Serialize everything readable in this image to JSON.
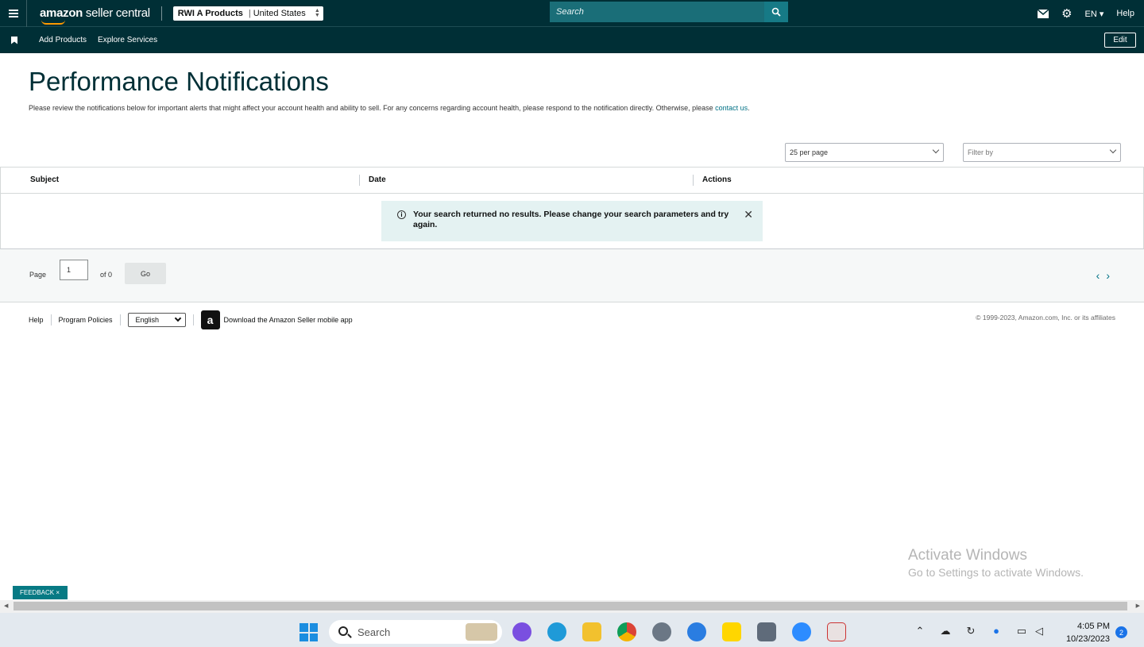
{
  "topbar": {
    "logo_bold": "amazon",
    "logo_rest": " seller central",
    "account_name": "RWI A Products",
    "account_separator": "|",
    "account_region": "United States",
    "search_placeholder": "Search",
    "language": "EN",
    "help": "Help"
  },
  "navbar": {
    "links": [
      "Add Products",
      "Explore Services"
    ],
    "edit_label": "Edit"
  },
  "page": {
    "title": "Performance Notifications",
    "description": "Please review the notifications below for important alerts that might affect your account health and ability to sell. For any concerns regarding account health, please respond to the notification directly. Otherwise, please ",
    "contact_link": "contact us",
    "description_end": ".",
    "per_page": "25 per page",
    "filter_placeholder": "Filter by"
  },
  "table": {
    "columns": [
      "Subject",
      "Date",
      "Actions"
    ]
  },
  "alert": {
    "message": "Your search returned no results. Please change your search parameters and try again.",
    "close": "✕"
  },
  "pager": {
    "page_label": "Page",
    "page_value": "1",
    "of_label": "of 0",
    "go_label": "Go"
  },
  "footer": {
    "help": "Help",
    "program_policies": "Program Policies",
    "language": "English",
    "app_text": "Download the Amazon Seller mobile app",
    "copyright": "© 1999-2023, Amazon.com, Inc. or its affiliates"
  },
  "watermark": {
    "line1": "Activate Windows",
    "line2": "Go to Settings to activate Windows."
  },
  "feedback": "FEEDBACK ×",
  "taskbar": {
    "search_label": "Search",
    "time": "4:05 PM",
    "date": "10/23/2023",
    "notification_count": "2"
  },
  "colors": {
    "header_bg": "#002f36",
    "accent": "#007185",
    "alert_bg": "#e4f2f2",
    "feedback_bg": "#077a84"
  }
}
